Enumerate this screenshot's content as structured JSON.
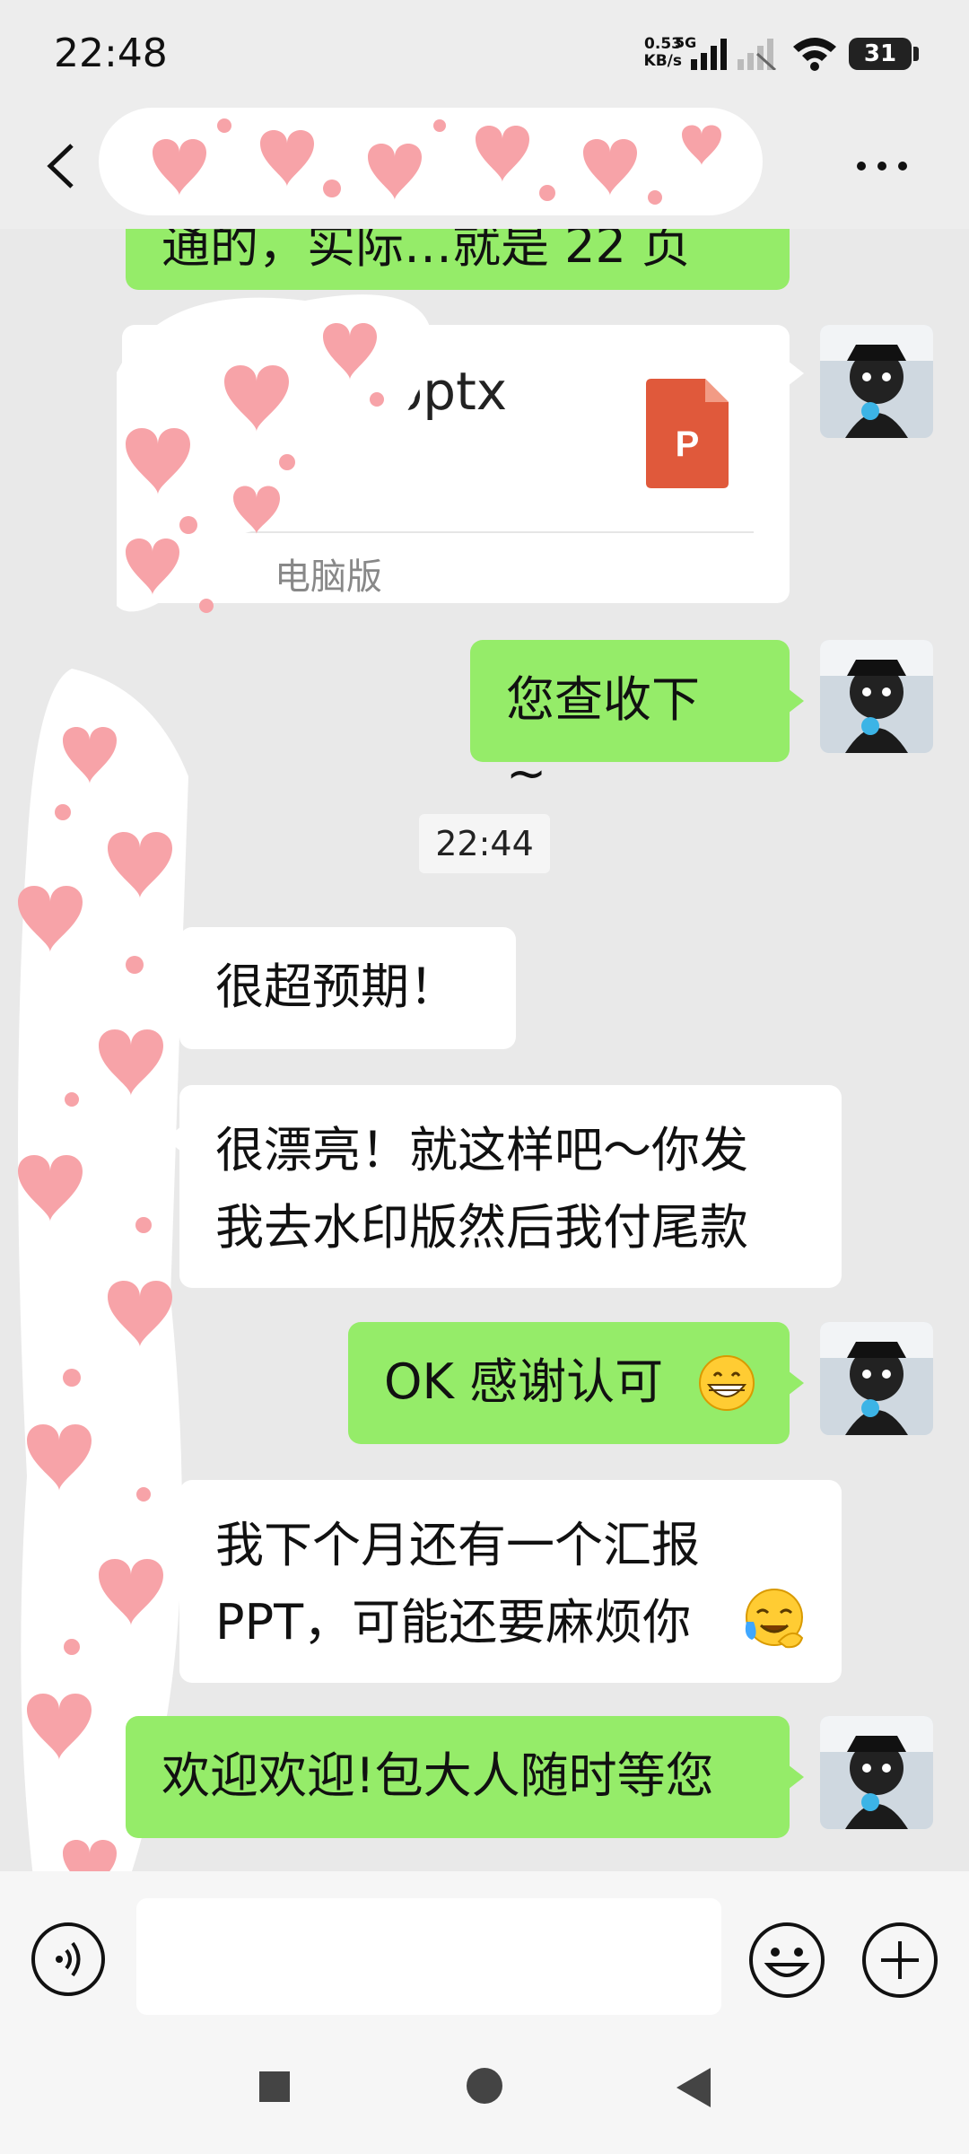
{
  "status_bar": {
    "time": "22:48",
    "net_speed_value": "0.53",
    "net_speed_unit": "KB/s",
    "network_type": "5G",
    "battery_level": "31",
    "icons": [
      "signal-icon",
      "signal-off-icon",
      "wifi-icon",
      "battery-icon"
    ]
  },
  "header": {
    "back_icon": "back-arrow-icon",
    "more_icon": "more-dots-icon"
  },
  "messages": [
    {
      "side": "right",
      "text": "通的，实际…就是 22 页",
      "partially_visible": true
    },
    {
      "side": "right",
      "type": "file",
      "file_name": ".pptx",
      "file_source": "电脑版",
      "file_icon": "powerpoint-icon"
    },
    {
      "side": "right",
      "text": "您查收下 ~"
    },
    {
      "type": "timestamp",
      "text": "22:44"
    },
    {
      "side": "left",
      "text": "很超预期！"
    },
    {
      "side": "left",
      "lines": [
        "很漂亮！就这样吧～你发",
        "我去水印版然后我付尾款"
      ]
    },
    {
      "side": "right",
      "text": "OK 感谢认可",
      "emoji": "grinning-face-icon"
    },
    {
      "side": "left",
      "lines": [
        "我下个月还有一个汇报",
        "PPT，可能还要麻烦你"
      ],
      "emoji": "crying-face-icon"
    },
    {
      "side": "right",
      "text": "欢迎欢迎!包大人随时等您"
    }
  ],
  "input_bar": {
    "voice_icon": "voice-icon",
    "emoji_icon": "emoji-icon",
    "plus_icon": "plus-icon",
    "input_value": ""
  },
  "nav_bar": {
    "icons": [
      "recent-apps-icon",
      "home-icon",
      "back-icon"
    ]
  },
  "colors": {
    "sent_bubble": "#95ec69",
    "received_bubble": "#ffffff",
    "chat_bg": "#e9e9e9",
    "ppt_orange": "#e0593b"
  }
}
